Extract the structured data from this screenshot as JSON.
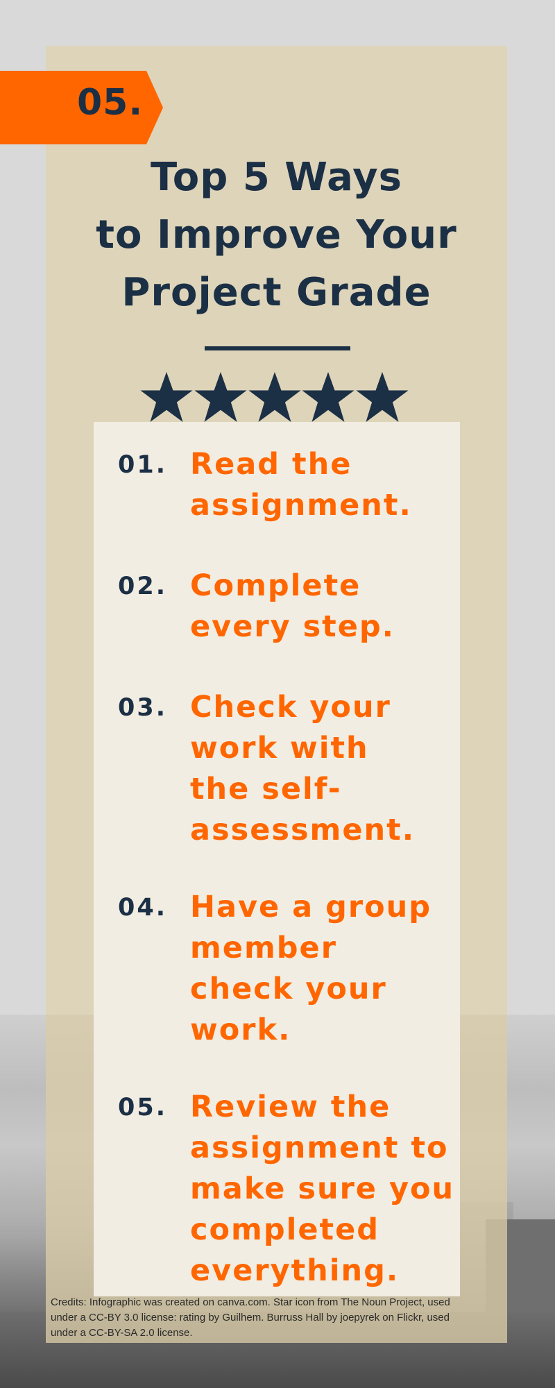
{
  "banner": {
    "number": "05."
  },
  "title": {
    "lines": [
      "Top 5 Ways",
      "to Improve Your",
      "Project Grade"
    ]
  },
  "rating": {
    "stars": 5,
    "max": 5,
    "icon": "star-icon"
  },
  "items": [
    {
      "number": "01.",
      "lines": [
        "Read the",
        "assignment."
      ]
    },
    {
      "number": "02.",
      "lines": [
        "Complete",
        "every step."
      ]
    },
    {
      "number": "03.",
      "lines": [
        "Check your",
        "work with",
        "the self-",
        "assessment."
      ]
    },
    {
      "number": "04.",
      "lines": [
        "Have a group",
        "member",
        "check your",
        "work."
      ]
    },
    {
      "number": "05.",
      "lines": [
        "Review the",
        "assignment to",
        "make sure you",
        "completed",
        "everything."
      ]
    }
  ],
  "credits": {
    "lines": [
      "Credits: Infographic was created on canva.com. Star icon from The Noun Project, used",
      "under a CC-BY 3.0 license: rating by Guilhem. Burruss Hall by joepyrek on Flickr, used",
      "under a CC-BY-SA 2.0 license."
    ]
  },
  "colors": {
    "accent_orange": "#ff6600",
    "navy": "#1b2f45",
    "panel_beige": "#ded4b9",
    "inner_cream": "#f2ede2",
    "background_gray": "#d9d9d9"
  }
}
